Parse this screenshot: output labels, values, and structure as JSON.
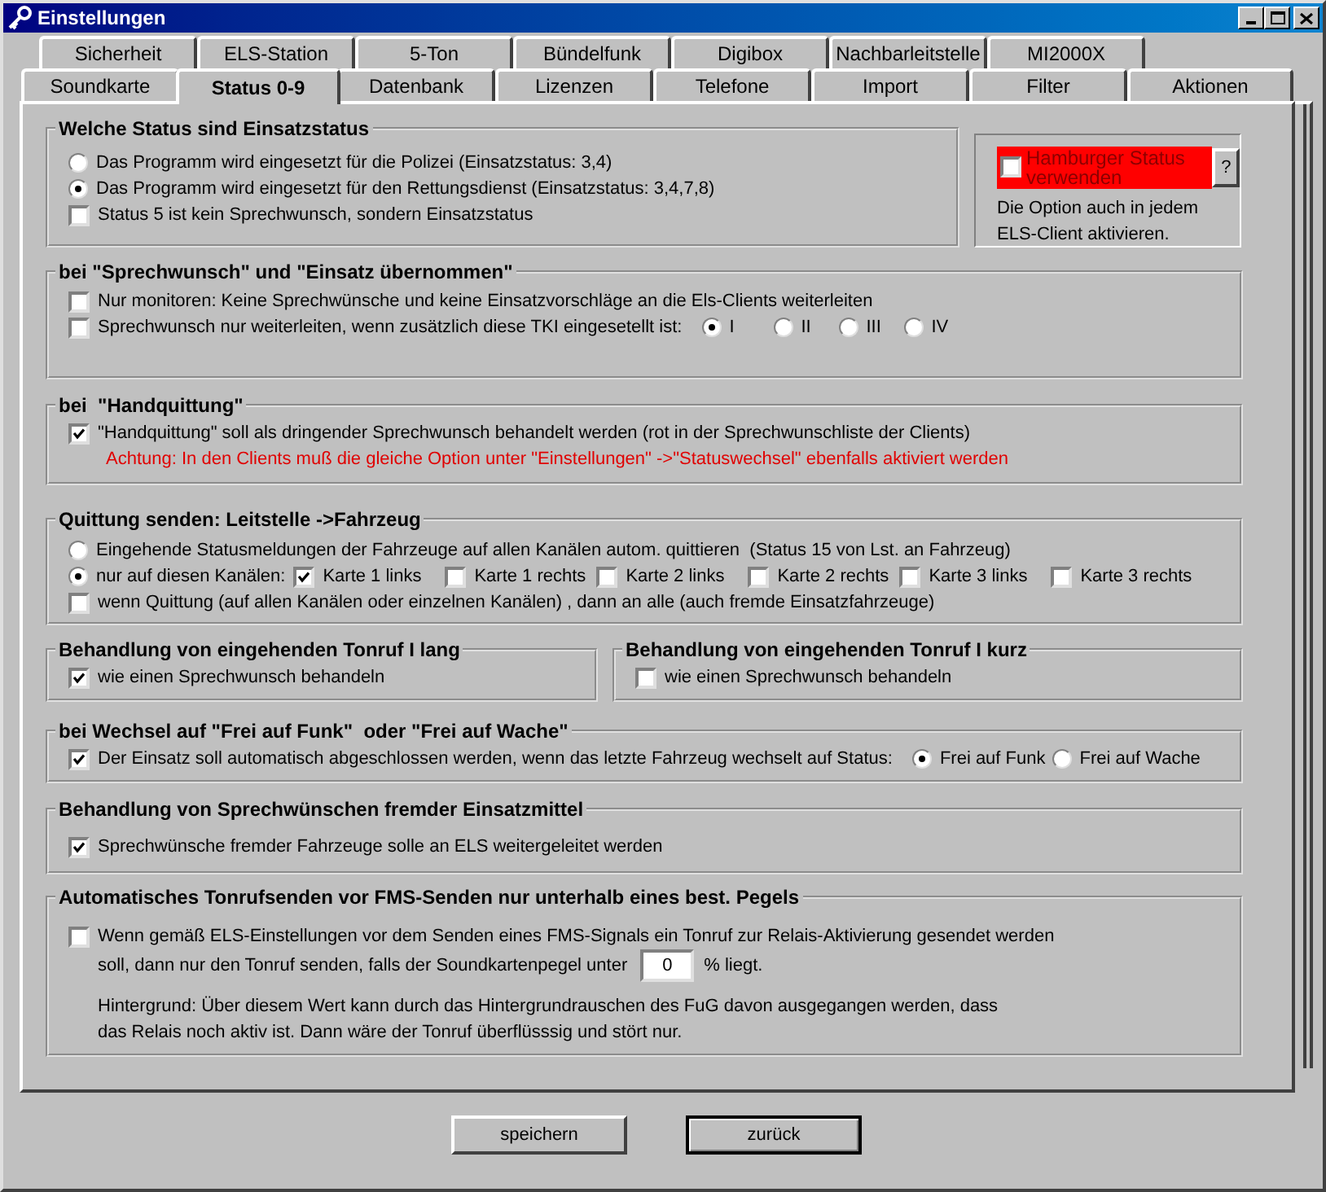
{
  "window": {
    "title": "Einstellungen"
  },
  "tab_rows": [
    [
      {
        "label": "Sicherheit",
        "selected": false
      },
      {
        "label": "ELS-Station",
        "selected": false
      },
      {
        "label": "5-Ton",
        "selected": false
      },
      {
        "label": "Bündelfunk",
        "selected": false
      },
      {
        "label": "Digibox",
        "selected": false
      },
      {
        "label": "Nachbarleitstelle",
        "selected": false
      },
      {
        "label": "MI2000X",
        "selected": false
      }
    ],
    [
      {
        "label": "Soundkarte",
        "selected": false
      },
      {
        "label": "Status 0-9",
        "selected": true
      },
      {
        "label": "Datenbank",
        "selected": false
      },
      {
        "label": "Lizenzen",
        "selected": false
      },
      {
        "label": "Telefone",
        "selected": false
      },
      {
        "label": "Import",
        "selected": false
      },
      {
        "label": "Filter",
        "selected": false
      },
      {
        "label": "Aktionen",
        "selected": false
      }
    ]
  ],
  "group_rows": [
    [
      {
        "kind": "frame",
        "title": "Welche Status sind Einsatzstatus",
        "lines": [
          [
            {
              "kind": "radio",
              "label": "Das Programm wird eingesetzt für die Polizei (Einsatzstatus: 3,4)",
              "selected": false
            }
          ],
          [
            {
              "kind": "radio",
              "label": "Das Programm wird eingesetzt für den Rettungsdienst (Einsatzstatus: 3,4,7,8)",
              "selected": true
            }
          ],
          [
            {
              "kind": "checkbox",
              "label": "Status 5 ist kein Sprechwunsch, sondern Einsatzstatus",
              "checked": false
            }
          ]
        ]
      },
      {
        "kind": "panel",
        "lines": [
          [
            {
              "kind": "highlight_checkbox",
              "label": "Hamburger Status verwenden",
              "checked": false
            },
            {
              "kind": "help_button",
              "label": "?"
            }
          ],
          [
            {
              "kind": "text",
              "text": "Die Option auch in jedem"
            }
          ],
          [
            {
              "kind": "text",
              "text": "ELS-Client aktivieren."
            }
          ]
        ]
      }
    ],
    [
      {
        "kind": "frame",
        "title": "bei \"Sprechwunsch\" und \"Einsatz übernommen\"",
        "lines": [
          [
            {
              "kind": "checkbox",
              "label": "Nur monitoren: Keine Sprechwünsche und keine Einsatzvorschläge an die Els-Clients weiterleiten",
              "checked": false
            }
          ],
          [
            {
              "kind": "checkbox",
              "label": "Sprechwunsch nur weiterleiten, wenn zusätzlich diese TKI eingesetellt ist:",
              "checked": false
            },
            {
              "kind": "radio",
              "label": "I",
              "selected": true
            },
            {
              "kind": "radio",
              "label": "II",
              "selected": false
            },
            {
              "kind": "radio",
              "label": "III",
              "selected": false
            },
            {
              "kind": "radio",
              "label": "IV",
              "selected": false
            }
          ]
        ]
      }
    ],
    [
      {
        "kind": "frame",
        "title": "bei  \"Handquittung\"",
        "lines": [
          [
            {
              "kind": "checkbox",
              "label": "\"Handquittung\" soll als dringender Sprechwunsch behandelt werden (rot in der Sprechwunschliste der Clients)",
              "checked": true
            }
          ],
          [
            {
              "kind": "warning",
              "text": "Achtung: In den Clients muß die gleiche Option unter \"Einstellungen\" ->\"Statuswechsel\" ebenfalls aktiviert werden"
            }
          ]
        ]
      }
    ],
    [
      {
        "kind": "frame",
        "title": "Quittung senden: Leitstelle ->Fahrzeug",
        "lines": [
          [
            {
              "kind": "radio",
              "label": "Eingehende Statusmeldungen der Fahrzeuge auf allen Kanälen autom. quittieren  (Status 15 von Lst. an Fahrzeug)",
              "selected": false
            }
          ],
          [
            {
              "kind": "radio",
              "label": "nur auf diesen Kanälen:",
              "selected": true
            },
            {
              "kind": "checkbox",
              "label": "Karte 1 links",
              "checked": true
            },
            {
              "kind": "checkbox",
              "label": "Karte 1 rechts",
              "checked": false
            },
            {
              "kind": "checkbox",
              "label": "Karte 2 links",
              "checked": false
            },
            {
              "kind": "checkbox",
              "label": "Karte 2 rechts",
              "checked": false
            },
            {
              "kind": "checkbox",
              "label": "Karte 3 links",
              "checked": false
            },
            {
              "kind": "checkbox",
              "label": "Karte 3 rechts",
              "checked": false
            }
          ],
          [
            {
              "kind": "checkbox",
              "label": "wenn Quittung (auf allen Kanälen oder einzelnen Kanälen) , dann an alle (auch fremde Einsatzfahrzeuge)",
              "checked": false
            }
          ]
        ]
      }
    ],
    [
      {
        "kind": "frame",
        "title": "Behandlung von eingehenden Tonruf I lang",
        "lines": [
          [
            {
              "kind": "checkbox",
              "label": "wie einen Sprechwunsch behandeln",
              "checked": true
            }
          ]
        ]
      },
      {
        "kind": "frame",
        "title": "Behandlung von eingehenden Tonruf I kurz",
        "lines": [
          [
            {
              "kind": "checkbox",
              "label": "wie einen Sprechwunsch behandeln",
              "checked": false
            }
          ]
        ]
      }
    ],
    [
      {
        "kind": "frame",
        "title": "bei Wechsel auf \"Frei auf Funk\"  oder \"Frei auf Wache\"",
        "lines": [
          [
            {
              "kind": "checkbox",
              "label": "Der Einsatz soll automatisch abgeschlossen werden, wenn das letzte Fahrzeug wechselt auf Status:",
              "checked": true
            },
            {
              "kind": "radio",
              "label": "Frei auf Funk",
              "selected": true
            },
            {
              "kind": "radio",
              "label": "Frei auf Wache",
              "selected": false
            }
          ]
        ]
      }
    ],
    [
      {
        "kind": "frame",
        "title": "Behandlung von Sprechwünschen fremder Einsatzmittel",
        "lines": [
          [
            {
              "kind": "checkbox",
              "label": "Sprechwünsche fremder Fahrzeuge solle an ELS weitergeleitet werden",
              "checked": true
            }
          ]
        ]
      }
    ],
    [
      {
        "kind": "frame",
        "title": "Automatisches Tonrufsenden vor FMS-Senden nur unterhalb eines best. Pegels",
        "lines": [
          [
            {
              "kind": "checkbox",
              "label": "Wenn gemäß ELS-Einstellungen vor dem Senden eines FMS-Signals ein Tonruf zur Relais-Aktivierung gesendet werden",
              "checked": false
            }
          ],
          [
            {
              "kind": "text",
              "text": "soll, dann nur den Tonruf senden, falls der Soundkartenpegel unter"
            },
            {
              "kind": "field",
              "value": "0"
            },
            {
              "kind": "text",
              "text": "% liegt."
            }
          ],
          [
            {
              "kind": "text",
              "text": "Hintergrund: Über diesem Wert kann durch das Hintergrundrauschen des FuG davon ausgegangen werden, dass"
            }
          ],
          [
            {
              "kind": "text",
              "text": "das Relais noch aktiv ist. Dann wäre der Tonruf überflüsssig und stört nur."
            }
          ]
        ]
      }
    ]
  ],
  "buttons": [
    {
      "label": "speichern",
      "focused": false
    },
    {
      "label": "zurück",
      "focused": true
    }
  ]
}
